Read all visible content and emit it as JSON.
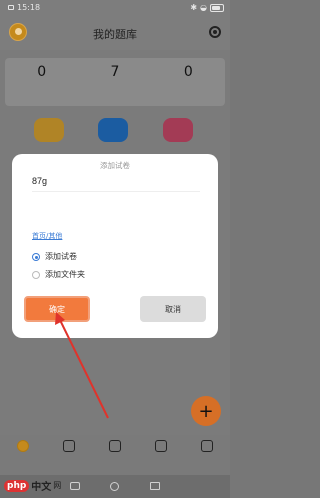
{
  "status_bar": {
    "time": "15:18",
    "battery": ""
  },
  "header": {
    "title": "我的题库"
  },
  "stats": [
    {
      "value": "0",
      "label": ""
    },
    {
      "value": "7",
      "label": ""
    },
    {
      "value": "0",
      "label": ""
    }
  ],
  "dialog": {
    "title": "添加试卷",
    "name_value": "87g",
    "path_link": "首页/其他",
    "options": [
      {
        "label": "添加试卷",
        "selected": true
      },
      {
        "label": "添加文件夹",
        "selected": false
      }
    ],
    "confirm_label": "确定",
    "cancel_label": "取消"
  },
  "fab": {
    "symbol": "+"
  },
  "tabs": [
    {
      "label": "",
      "active": true
    },
    {
      "label": "",
      "active": false
    },
    {
      "label": "",
      "active": false
    },
    {
      "label": "",
      "active": false
    },
    {
      "label": "",
      "active": false
    }
  ],
  "watermark": {
    "badge": "php",
    "text": "中文",
    "suffix": "网"
  },
  "colors": {
    "accent": "#f27a3d",
    "link": "#3a7bd5",
    "overlay": "#7b7b7b"
  }
}
